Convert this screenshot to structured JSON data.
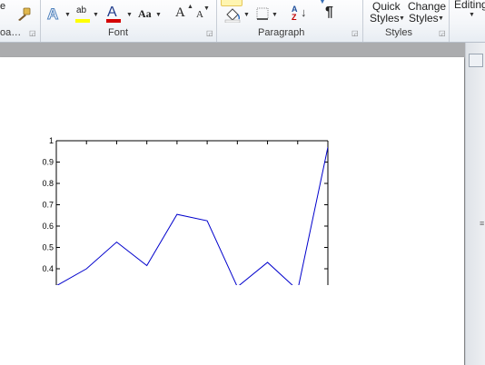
{
  "ribbon": {
    "clipboard": {
      "label_partial": "oa…",
      "cut_partial": "e"
    },
    "font": {
      "label": "Font",
      "grow_font": "A",
      "shrink_font": "A",
      "change_case": "Aa",
      "font_color_letter": "A",
      "text_effects_letter": "A",
      "highlight_letters": "ab"
    },
    "paragraph": {
      "label": "Paragraph",
      "pilcrow": "¶",
      "sort_top": "A",
      "sort_bottom": "Z"
    },
    "styles": {
      "label": "Styles",
      "quick_styles_line1": "Quick",
      "quick_styles_line2": "Styles",
      "change_styles_line1": "Change",
      "change_styles_line2": "Styles"
    },
    "editing": {
      "label": "Editing"
    }
  },
  "colors": {
    "highlight_yellow": "#ffff00",
    "font_color_red": "#d40000",
    "series_line": "#0000cc",
    "text_effects_blue": "#4f81bd"
  },
  "chart_data": {
    "type": "line",
    "x": [
      1,
      2,
      3,
      4,
      5,
      6,
      7,
      8,
      9,
      10
    ],
    "series": [
      {
        "values": [
          0.32,
          0.4,
          0.525,
          0.415,
          0.655,
          0.625,
          0.315,
          0.43,
          0.3,
          0.97
        ]
      }
    ],
    "yticks": [
      "0.4",
      "0.5",
      "0.6",
      "0.7",
      "0.8",
      "0.9",
      "1"
    ],
    "ylim": [
      0.33,
      1
    ],
    "xlim": [
      1,
      10
    ],
    "title": "",
    "xlabel": "",
    "ylabel": ""
  }
}
